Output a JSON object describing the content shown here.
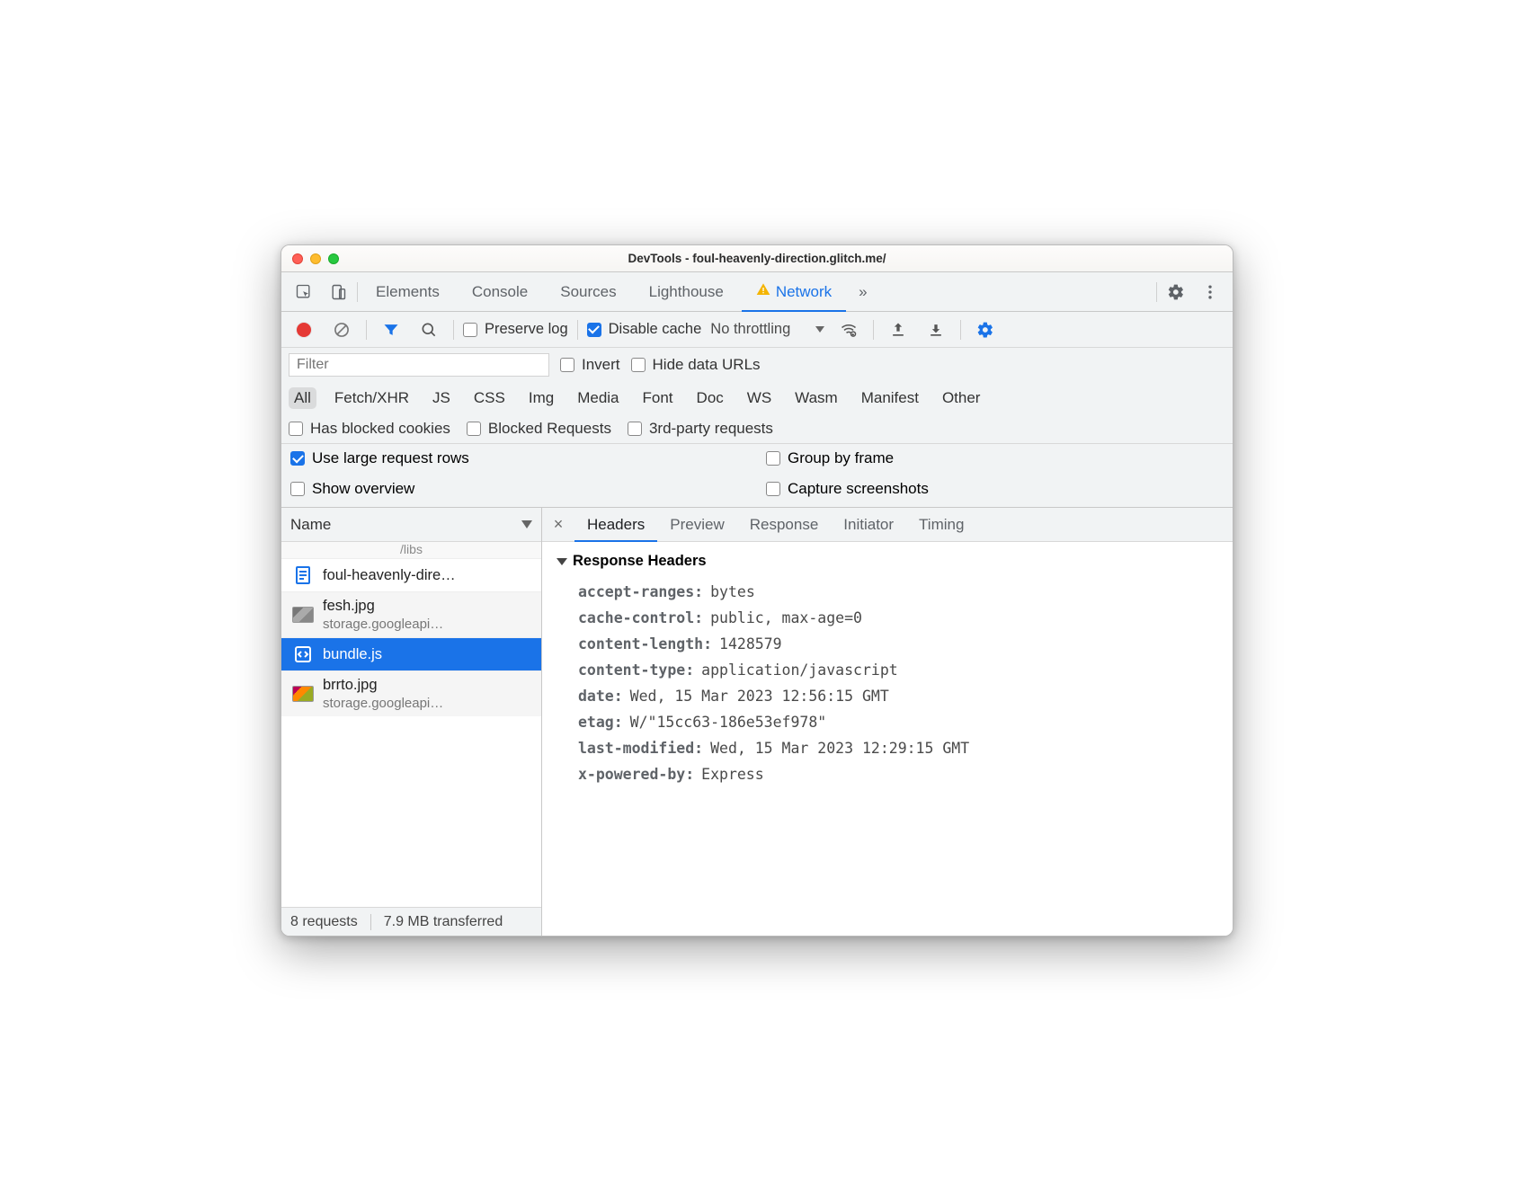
{
  "window": {
    "title": "DevTools - foul-heavenly-direction.glitch.me/"
  },
  "tabs": {
    "elements": "Elements",
    "console": "Console",
    "sources": "Sources",
    "lighthouse": "Lighthouse",
    "network": "Network",
    "more": "»"
  },
  "toolbar": {
    "preserve_log": "Preserve log",
    "preserve_log_checked": false,
    "disable_cache": "Disable cache",
    "disable_cache_checked": true,
    "throttling": "No throttling"
  },
  "filter": {
    "placeholder": "Filter",
    "invert": "Invert",
    "hide_data_urls": "Hide data URLs",
    "types": [
      "All",
      "Fetch/XHR",
      "JS",
      "CSS",
      "Img",
      "Media",
      "Font",
      "Doc",
      "WS",
      "Wasm",
      "Manifest",
      "Other"
    ],
    "has_blocked": "Has blocked cookies",
    "blocked_requests": "Blocked Requests",
    "third_party": "3rd-party requests"
  },
  "settings": {
    "use_large_rows": "Use large request rows",
    "use_large_rows_checked": true,
    "group_by_frame": "Group by frame",
    "group_by_frame_checked": false,
    "show_overview": "Show overview",
    "show_overview_checked": false,
    "capture_screenshots": "Capture screenshots",
    "capture_screenshots_checked": false
  },
  "list": {
    "header": "Name",
    "truncated_top": "/libs",
    "rows": [
      {
        "icon": "doc",
        "name": "foul-heavenly-dire…",
        "sub": ""
      },
      {
        "icon": "img",
        "name": "fesh.jpg",
        "sub": "storage.googleapi…"
      },
      {
        "icon": "js",
        "name": "bundle.js",
        "sub": "",
        "selected": true
      },
      {
        "icon": "img2",
        "name": "brrto.jpg",
        "sub": "storage.googleapi…"
      }
    ]
  },
  "details": {
    "tabs": [
      "Headers",
      "Preview",
      "Response",
      "Initiator",
      "Timing"
    ],
    "active_tab": "Headers",
    "section_title": "Response Headers",
    "headers": [
      {
        "k": "accept-ranges:",
        "v": "bytes"
      },
      {
        "k": "cache-control:",
        "v": "public, max-age=0"
      },
      {
        "k": "content-length:",
        "v": "1428579"
      },
      {
        "k": "content-type:",
        "v": "application/javascript"
      },
      {
        "k": "date:",
        "v": "Wed, 15 Mar 2023 12:56:15 GMT"
      },
      {
        "k": "etag:",
        "v": "W/\"15cc63-186e53ef978\""
      },
      {
        "k": "last-modified:",
        "v": "Wed, 15 Mar 2023 12:29:15 GMT"
      },
      {
        "k": "x-powered-by:",
        "v": "Express"
      }
    ]
  },
  "statusbar": {
    "requests": "8 requests",
    "transferred": "7.9 MB transferred"
  }
}
